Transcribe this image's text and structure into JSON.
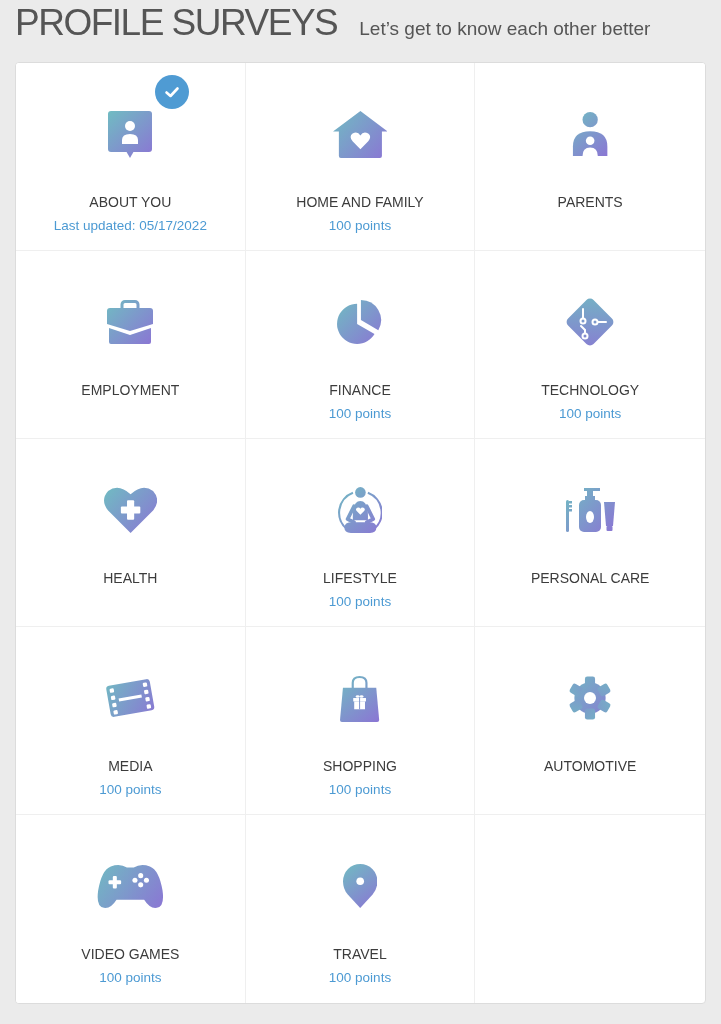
{
  "header": {
    "title": "PROFILE SURVEYS",
    "subtitle": "Let’s get to know each other better"
  },
  "surveys": [
    {
      "title": "ABOUT YOU",
      "note": "Last updated: 05/17/2022",
      "completed": true
    },
    {
      "title": "HOME AND FAMILY",
      "note": "100 points",
      "completed": false
    },
    {
      "title": "PARENTS",
      "completed": false
    },
    {
      "title": "EMPLOYMENT",
      "completed": false
    },
    {
      "title": "FINANCE",
      "note": "100 points",
      "completed": false
    },
    {
      "title": "TECHNOLOGY",
      "note": "100 points",
      "completed": false
    },
    {
      "title": "HEALTH",
      "completed": false
    },
    {
      "title": "LIFESTYLE",
      "note": "100 points",
      "completed": false
    },
    {
      "title": "PERSONAL CARE",
      "completed": false
    },
    {
      "title": "MEDIA",
      "note": "100 points",
      "completed": false
    },
    {
      "title": "SHOPPING",
      "note": "100 points",
      "completed": false
    },
    {
      "title": "AUTOMOTIVE",
      "completed": false
    },
    {
      "title": "VIDEO GAMES",
      "note": "100 points",
      "completed": false
    },
    {
      "title": "TRAVEL",
      "note": "100 points",
      "completed": false
    }
  ]
}
